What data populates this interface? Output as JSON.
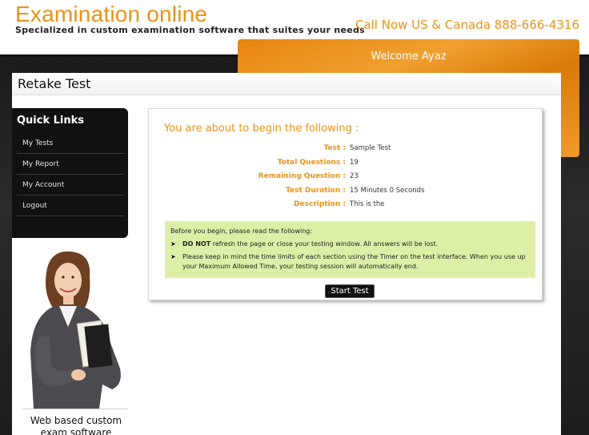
{
  "header": {
    "brand_title": "Examination online",
    "brand_tagline": "Specialized in custom examination software that suites your needs",
    "call_now": "Call Now US & Canada 888-666-4316"
  },
  "welcome": {
    "text": "Welcome Ayaz"
  },
  "page": {
    "title": "Retake Test"
  },
  "quick_links": {
    "title": "Quick Links",
    "items": [
      {
        "label": "My Tests"
      },
      {
        "label": "My Report"
      },
      {
        "label": "My Account"
      },
      {
        "label": "Logout"
      }
    ]
  },
  "sidebar": {
    "caption_line1": "Web based custom",
    "caption_line2": "exam software"
  },
  "test": {
    "heading": "You are about to begin the following :",
    "rows": [
      {
        "label": "Test :",
        "value": "Sample Test"
      },
      {
        "label": "Total Questions :",
        "value": "19"
      },
      {
        "label": "Remaining Question :",
        "value": "23"
      },
      {
        "label": "Test Duration :",
        "value": "15 Minutes 0 Seconds"
      },
      {
        "label": "Description :",
        "value": "This is the"
      }
    ],
    "notice_intro": "Before you begin, please read the following:",
    "notice_1_bold": "DO NOT",
    "notice_1_rest": " refresh the page or close your testing window. All answers will be lost.",
    "notice_2": "Please keep in mind the time limits of each section using the Timer on the test interface. When you use up your Maximum Allowed Time, your testing session will automatically end.",
    "start_label": "Start Test"
  },
  "colors": {
    "accent_orange": "#e8931a",
    "welcome_bar": "#e8850f",
    "notice_green": "#dbf0a6",
    "dark_bg": "#1a1a1a"
  }
}
